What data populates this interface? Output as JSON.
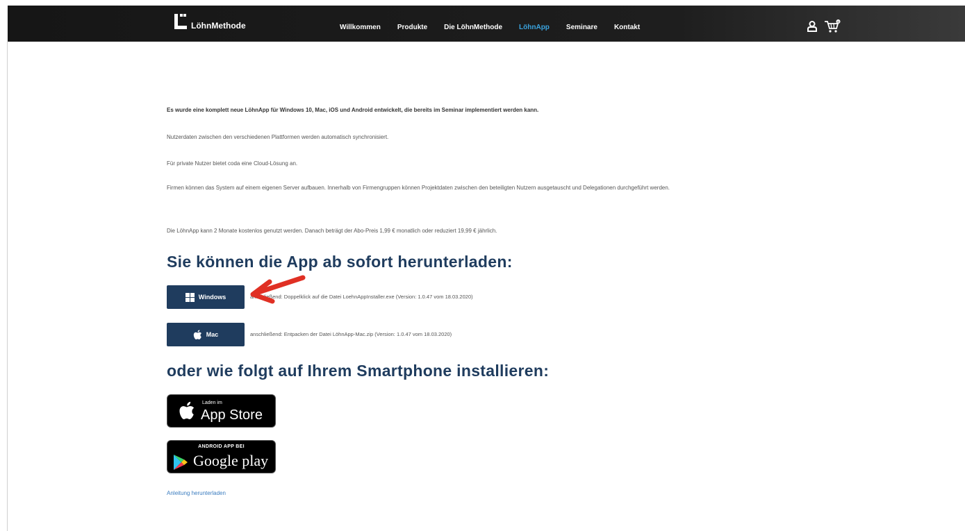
{
  "brand": {
    "name": "LöhnMethode"
  },
  "nav": {
    "items": [
      "Willkommen",
      "Produkte",
      "Die LöhnMethode",
      "LöhnApp",
      "Seminare",
      "Kontakt"
    ],
    "active": "LöhnApp"
  },
  "header": {
    "user_icon": "user-icon",
    "cart_icon": "cart-icon",
    "cart_count": "0"
  },
  "intro": {
    "p1": "Es wurde eine komplett neue LöhnApp für Windows 10, Mac, iOS und Android entwickelt, die bereits im Seminar implementiert werden kann.",
    "p2": "Nutzerdaten zwischen den verschiedenen Plattformen werden automatisch synchronisiert.",
    "p3": "Für private Nutzer bietet coda eine Cloud-Lösung an.",
    "p4": "Firmen können das System auf einem eigenen Server aufbauen. Innerhalb von Firmengruppen können Projektdaten zwischen den beteiligten Nutzern ausgetauscht und Delegationen durchgeführt werden.",
    "p5": "Die LöhnApp kann 2 Monate kostenlos genutzt werden. Danach beträgt der Abo-Preis 1,99 € monatlich oder reduziert 19,99 € jährlich."
  },
  "download": {
    "heading": "Sie können die App ab sofort herunterladen:",
    "windows": {
      "label": "Windows",
      "note": "anschließend: Doppelklick auf die Datei LoehnAppInstaller.exe (Version: 1.0.47 vom 18.03.2020)"
    },
    "mac": {
      "label": "Mac",
      "note": "anschließend: Entpacken der Datei LöhnApp-Mac.zip (Version: 1.0.47 vom 18.03.2020)"
    }
  },
  "mobile": {
    "heading": "oder wie folgt auf Ihrem Smartphone installieren:",
    "appstore": {
      "small": "Laden im",
      "big": "App Store"
    },
    "googleplay": {
      "small": "ANDROID APP BEI",
      "big": "Google play"
    }
  },
  "footer_link": "Anleitung herunterladen",
  "colors": {
    "accent": "#1f3c5e",
    "nav_active": "#3aa3de",
    "arrow": "#e03024"
  }
}
